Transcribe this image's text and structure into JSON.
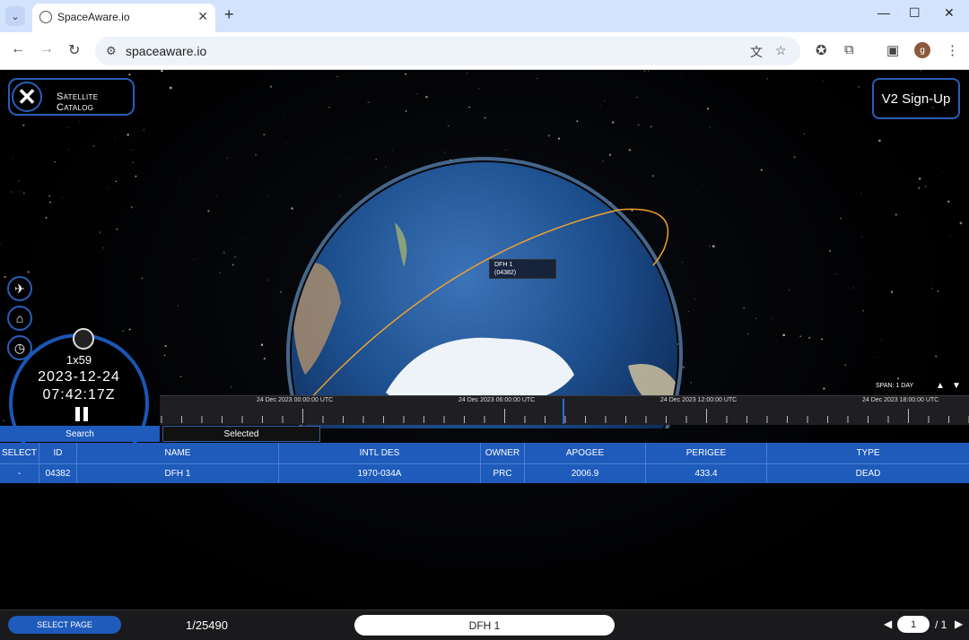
{
  "browser": {
    "tab_title": "SpaceAware.io",
    "new_tab": "+",
    "url": "spaceaware.io",
    "profile_initial": "g"
  },
  "app": {
    "catalog_label": "Satellite Catalog",
    "signup_label": "V2 Sign-Up",
    "tooltip": {
      "name": "DFH 1",
      "id": "(04382)"
    },
    "clock": {
      "rate": "1x59",
      "date": "2023-12-24",
      "time": "07:42:17Z"
    },
    "span_label": "SPAN: 1 DAY",
    "timeline_labels": [
      "24 Dec 2023 00:00:00 UTC",
      "24 Dec 2023 06:00:00 UTC",
      "24 Dec 2023 12:00:00 UTC",
      "24 Dec 2023 18:00:00 UTC"
    ],
    "tabs": {
      "search": "Search",
      "selected": "Selected"
    },
    "table": {
      "headers": [
        "SELECT",
        "ID",
        "NAME",
        "INTL DES",
        "OWNER",
        "APOGEE",
        "PERIGEE",
        "TYPE"
      ],
      "rows": [
        [
          "-",
          "04382",
          "DFH 1",
          "1970-034A",
          "PRC",
          "2006.9",
          "433.4",
          "DEAD"
        ]
      ]
    },
    "bottom": {
      "select_page": "SELECT PAGE",
      "count": "1/25490",
      "search_value": "DFH 1",
      "page_current": "1",
      "page_total": "/ 1"
    }
  },
  "colors": {
    "accent": "#1e5bbb",
    "orbit": "#f0a030"
  }
}
